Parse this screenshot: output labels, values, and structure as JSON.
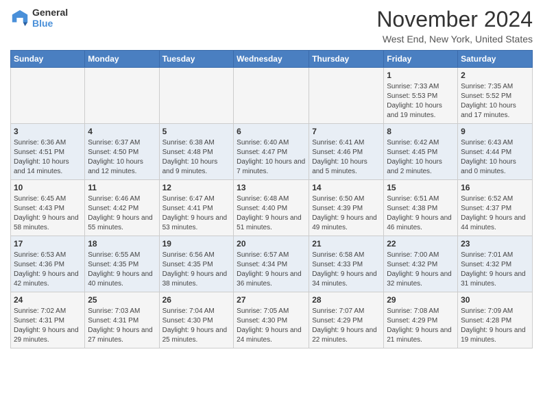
{
  "logo": {
    "general": "General",
    "blue": "Blue"
  },
  "header": {
    "month": "November 2024",
    "location": "West End, New York, United States"
  },
  "weekdays": [
    "Sunday",
    "Monday",
    "Tuesday",
    "Wednesday",
    "Thursday",
    "Friday",
    "Saturday"
  ],
  "weeks": [
    [
      {
        "day": "",
        "detail": ""
      },
      {
        "day": "",
        "detail": ""
      },
      {
        "day": "",
        "detail": ""
      },
      {
        "day": "",
        "detail": ""
      },
      {
        "day": "",
        "detail": ""
      },
      {
        "day": "1",
        "detail": "Sunrise: 7:33 AM\nSunset: 5:53 PM\nDaylight: 10 hours and 19 minutes."
      },
      {
        "day": "2",
        "detail": "Sunrise: 7:35 AM\nSunset: 5:52 PM\nDaylight: 10 hours and 17 minutes."
      }
    ],
    [
      {
        "day": "3",
        "detail": "Sunrise: 6:36 AM\nSunset: 4:51 PM\nDaylight: 10 hours and 14 minutes."
      },
      {
        "day": "4",
        "detail": "Sunrise: 6:37 AM\nSunset: 4:50 PM\nDaylight: 10 hours and 12 minutes."
      },
      {
        "day": "5",
        "detail": "Sunrise: 6:38 AM\nSunset: 4:48 PM\nDaylight: 10 hours and 9 minutes."
      },
      {
        "day": "6",
        "detail": "Sunrise: 6:40 AM\nSunset: 4:47 PM\nDaylight: 10 hours and 7 minutes."
      },
      {
        "day": "7",
        "detail": "Sunrise: 6:41 AM\nSunset: 4:46 PM\nDaylight: 10 hours and 5 minutes."
      },
      {
        "day": "8",
        "detail": "Sunrise: 6:42 AM\nSunset: 4:45 PM\nDaylight: 10 hours and 2 minutes."
      },
      {
        "day": "9",
        "detail": "Sunrise: 6:43 AM\nSunset: 4:44 PM\nDaylight: 10 hours and 0 minutes."
      }
    ],
    [
      {
        "day": "10",
        "detail": "Sunrise: 6:45 AM\nSunset: 4:43 PM\nDaylight: 9 hours and 58 minutes."
      },
      {
        "day": "11",
        "detail": "Sunrise: 6:46 AM\nSunset: 4:42 PM\nDaylight: 9 hours and 55 minutes."
      },
      {
        "day": "12",
        "detail": "Sunrise: 6:47 AM\nSunset: 4:41 PM\nDaylight: 9 hours and 53 minutes."
      },
      {
        "day": "13",
        "detail": "Sunrise: 6:48 AM\nSunset: 4:40 PM\nDaylight: 9 hours and 51 minutes."
      },
      {
        "day": "14",
        "detail": "Sunrise: 6:50 AM\nSunset: 4:39 PM\nDaylight: 9 hours and 49 minutes."
      },
      {
        "day": "15",
        "detail": "Sunrise: 6:51 AM\nSunset: 4:38 PM\nDaylight: 9 hours and 46 minutes."
      },
      {
        "day": "16",
        "detail": "Sunrise: 6:52 AM\nSunset: 4:37 PM\nDaylight: 9 hours and 44 minutes."
      }
    ],
    [
      {
        "day": "17",
        "detail": "Sunrise: 6:53 AM\nSunset: 4:36 PM\nDaylight: 9 hours and 42 minutes."
      },
      {
        "day": "18",
        "detail": "Sunrise: 6:55 AM\nSunset: 4:35 PM\nDaylight: 9 hours and 40 minutes."
      },
      {
        "day": "19",
        "detail": "Sunrise: 6:56 AM\nSunset: 4:35 PM\nDaylight: 9 hours and 38 minutes."
      },
      {
        "day": "20",
        "detail": "Sunrise: 6:57 AM\nSunset: 4:34 PM\nDaylight: 9 hours and 36 minutes."
      },
      {
        "day": "21",
        "detail": "Sunrise: 6:58 AM\nSunset: 4:33 PM\nDaylight: 9 hours and 34 minutes."
      },
      {
        "day": "22",
        "detail": "Sunrise: 7:00 AM\nSunset: 4:32 PM\nDaylight: 9 hours and 32 minutes."
      },
      {
        "day": "23",
        "detail": "Sunrise: 7:01 AM\nSunset: 4:32 PM\nDaylight: 9 hours and 31 minutes."
      }
    ],
    [
      {
        "day": "24",
        "detail": "Sunrise: 7:02 AM\nSunset: 4:31 PM\nDaylight: 9 hours and 29 minutes."
      },
      {
        "day": "25",
        "detail": "Sunrise: 7:03 AM\nSunset: 4:31 PM\nDaylight: 9 hours and 27 minutes."
      },
      {
        "day": "26",
        "detail": "Sunrise: 7:04 AM\nSunset: 4:30 PM\nDaylight: 9 hours and 25 minutes."
      },
      {
        "day": "27",
        "detail": "Sunrise: 7:05 AM\nSunset: 4:30 PM\nDaylight: 9 hours and 24 minutes."
      },
      {
        "day": "28",
        "detail": "Sunrise: 7:07 AM\nSunset: 4:29 PM\nDaylight: 9 hours and 22 minutes."
      },
      {
        "day": "29",
        "detail": "Sunrise: 7:08 AM\nSunset: 4:29 PM\nDaylight: 9 hours and 21 minutes."
      },
      {
        "day": "30",
        "detail": "Sunrise: 7:09 AM\nSunset: 4:28 PM\nDaylight: 9 hours and 19 minutes."
      }
    ]
  ]
}
